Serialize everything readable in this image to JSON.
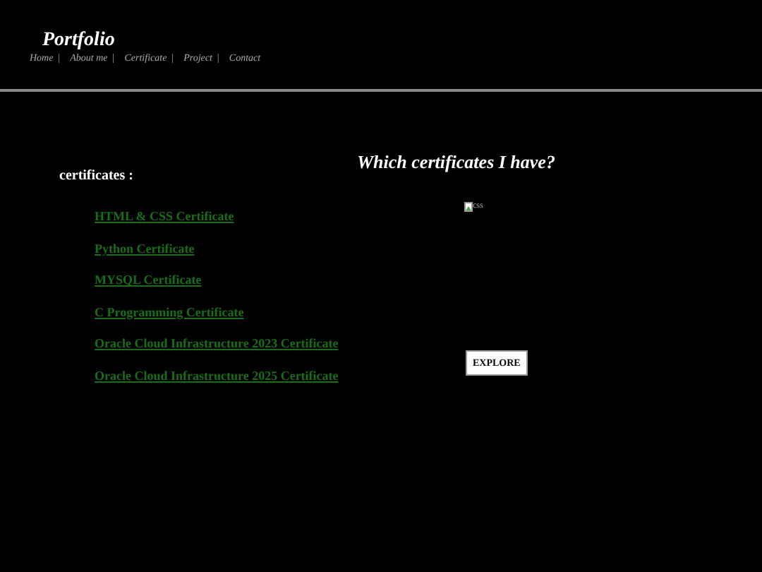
{
  "header": {
    "title": "Portfolio",
    "nav": [
      {
        "label": "Home"
      },
      {
        "label": "About me"
      },
      {
        "label": "Certificate"
      },
      {
        "label": "Project"
      },
      {
        "label": "Contact"
      }
    ],
    "separator": "|"
  },
  "heading": "Which certificates I have?",
  "certificates": {
    "label": "certificates :",
    "links": [
      "HTML & CSS Certificate",
      "Python Certificate",
      "MYSQL Certificate",
      "C Programming Certificate",
      "Oracle Cloud Infrastructure 2023 Certificate",
      "Oracle Cloud Infrastructure 2025 Certificate"
    ]
  },
  "image": {
    "alt": "css"
  },
  "button": "EXPLORE"
}
